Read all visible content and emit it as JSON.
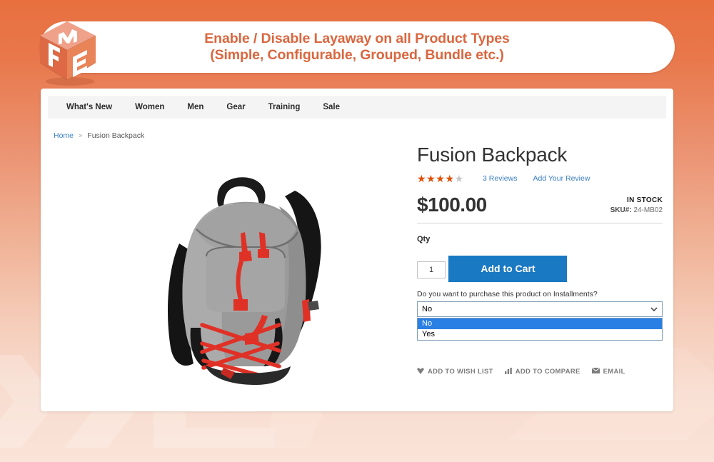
{
  "banner": {
    "line1": "Enable / Disable Layaway on all Product Types",
    "line2": "(Simple, Configurable, Grouped, Bundle etc.)",
    "accent_color": "#d9673f",
    "logo_alt": "FME"
  },
  "nav": {
    "items": [
      {
        "label": "What's New"
      },
      {
        "label": "Women"
      },
      {
        "label": "Men"
      },
      {
        "label": "Gear"
      },
      {
        "label": "Training"
      },
      {
        "label": "Sale"
      }
    ]
  },
  "breadcrumb": {
    "home": "Home",
    "separator": ">",
    "current": "Fusion Backpack"
  },
  "product": {
    "title": "Fusion Backpack",
    "rating_value": 3.5,
    "rating_max": 5,
    "rating_percent": "70%",
    "reviews_count": "3",
    "reviews_label": "Reviews",
    "add_review_label": "Add Your Review",
    "price": "$100.00",
    "stock_status": "IN STOCK",
    "sku_label": "SKU#:",
    "sku_value": "24-MB02",
    "qty_label": "Qty",
    "qty_value": "1",
    "add_to_cart_label": "Add to Cart",
    "image_alt": "Gray Fusion Backpack with red drawstrings"
  },
  "installments": {
    "question": "Do you want to purchase this product on Installments?",
    "selected_value": "No",
    "options": [
      {
        "label": "No",
        "selected": true
      },
      {
        "label": "Yes",
        "selected": false
      }
    ],
    "highlight_color": "#2a7fe5"
  },
  "actions": [
    {
      "label": "ADD TO WISH LIST",
      "icon": "heart-icon"
    },
    {
      "label": "ADD TO COMPARE",
      "icon": "compare-icon"
    },
    {
      "label": "EMAIL",
      "icon": "email-icon"
    }
  ],
  "theme": {
    "background_top": "#e8703f",
    "background_bottom": "#fae3d8",
    "button_blue": "#1979c3",
    "star_orange": "#e04e00",
    "link_blue": "#3a7fc4"
  }
}
